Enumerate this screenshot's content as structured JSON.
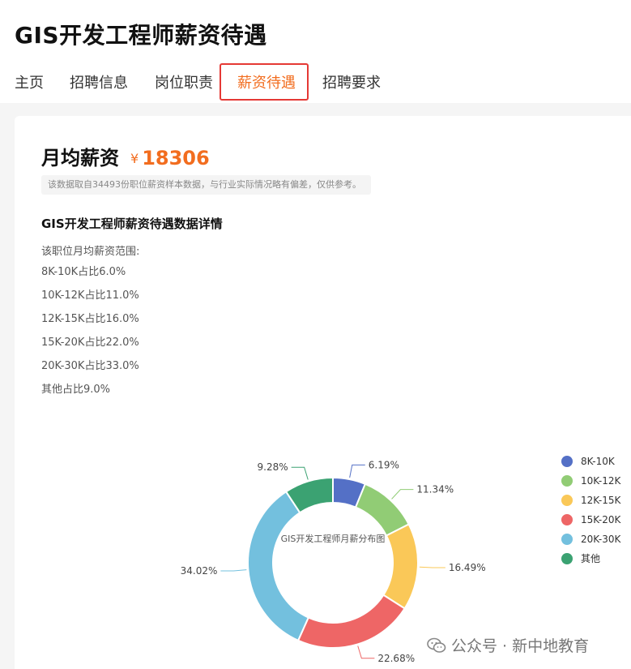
{
  "header": {
    "title": "GIS开发工程师薪资待遇"
  },
  "tabs": [
    {
      "label": "主页",
      "active": false
    },
    {
      "label": "招聘信息",
      "active": false
    },
    {
      "label": "岗位职责",
      "active": false
    },
    {
      "label": "薪资待遇",
      "active": true
    },
    {
      "label": "招聘要求",
      "active": false
    }
  ],
  "salary": {
    "label": "月均薪资",
    "currency": "¥",
    "value": "18306",
    "notice": "该数据取自34493份职位薪资样本数据，与行业实际情况略有偏差，仅供参考。"
  },
  "details": {
    "title": "GIS开发工程师薪资待遇数据详情",
    "intro": "该职位月均薪资范围:",
    "ranges": [
      "8K-10K占比6.0%",
      "10K-12K占比11.0%",
      "12K-15K占比16.0%",
      "15K-20K占比22.0%",
      "20K-30K占比33.0%",
      "其他占比9.0%"
    ]
  },
  "chart_data": {
    "type": "pie",
    "title": "GIS开发工程师月薪分布图",
    "categories": [
      "8K-10K",
      "10K-12K",
      "12K-15K",
      "15K-20K",
      "20K-30K",
      "其他"
    ],
    "values": [
      6.19,
      11.34,
      16.49,
      22.68,
      34.02,
      9.28
    ],
    "labels": [
      "6.19%",
      "11.34%",
      "16.49%",
      "22.68%",
      "34.02%",
      "9.28%"
    ],
    "colors": [
      "#5470c6",
      "#91cc75",
      "#fac858",
      "#ee6666",
      "#73c0de",
      "#3ba272"
    ],
    "legend_position": "right"
  },
  "watermark": {
    "text": "公众号 · 新中地教育",
    "icon": "wechat-icon"
  },
  "colors": {
    "accent": "#f26d1f",
    "highlight_border": "#e53935"
  }
}
